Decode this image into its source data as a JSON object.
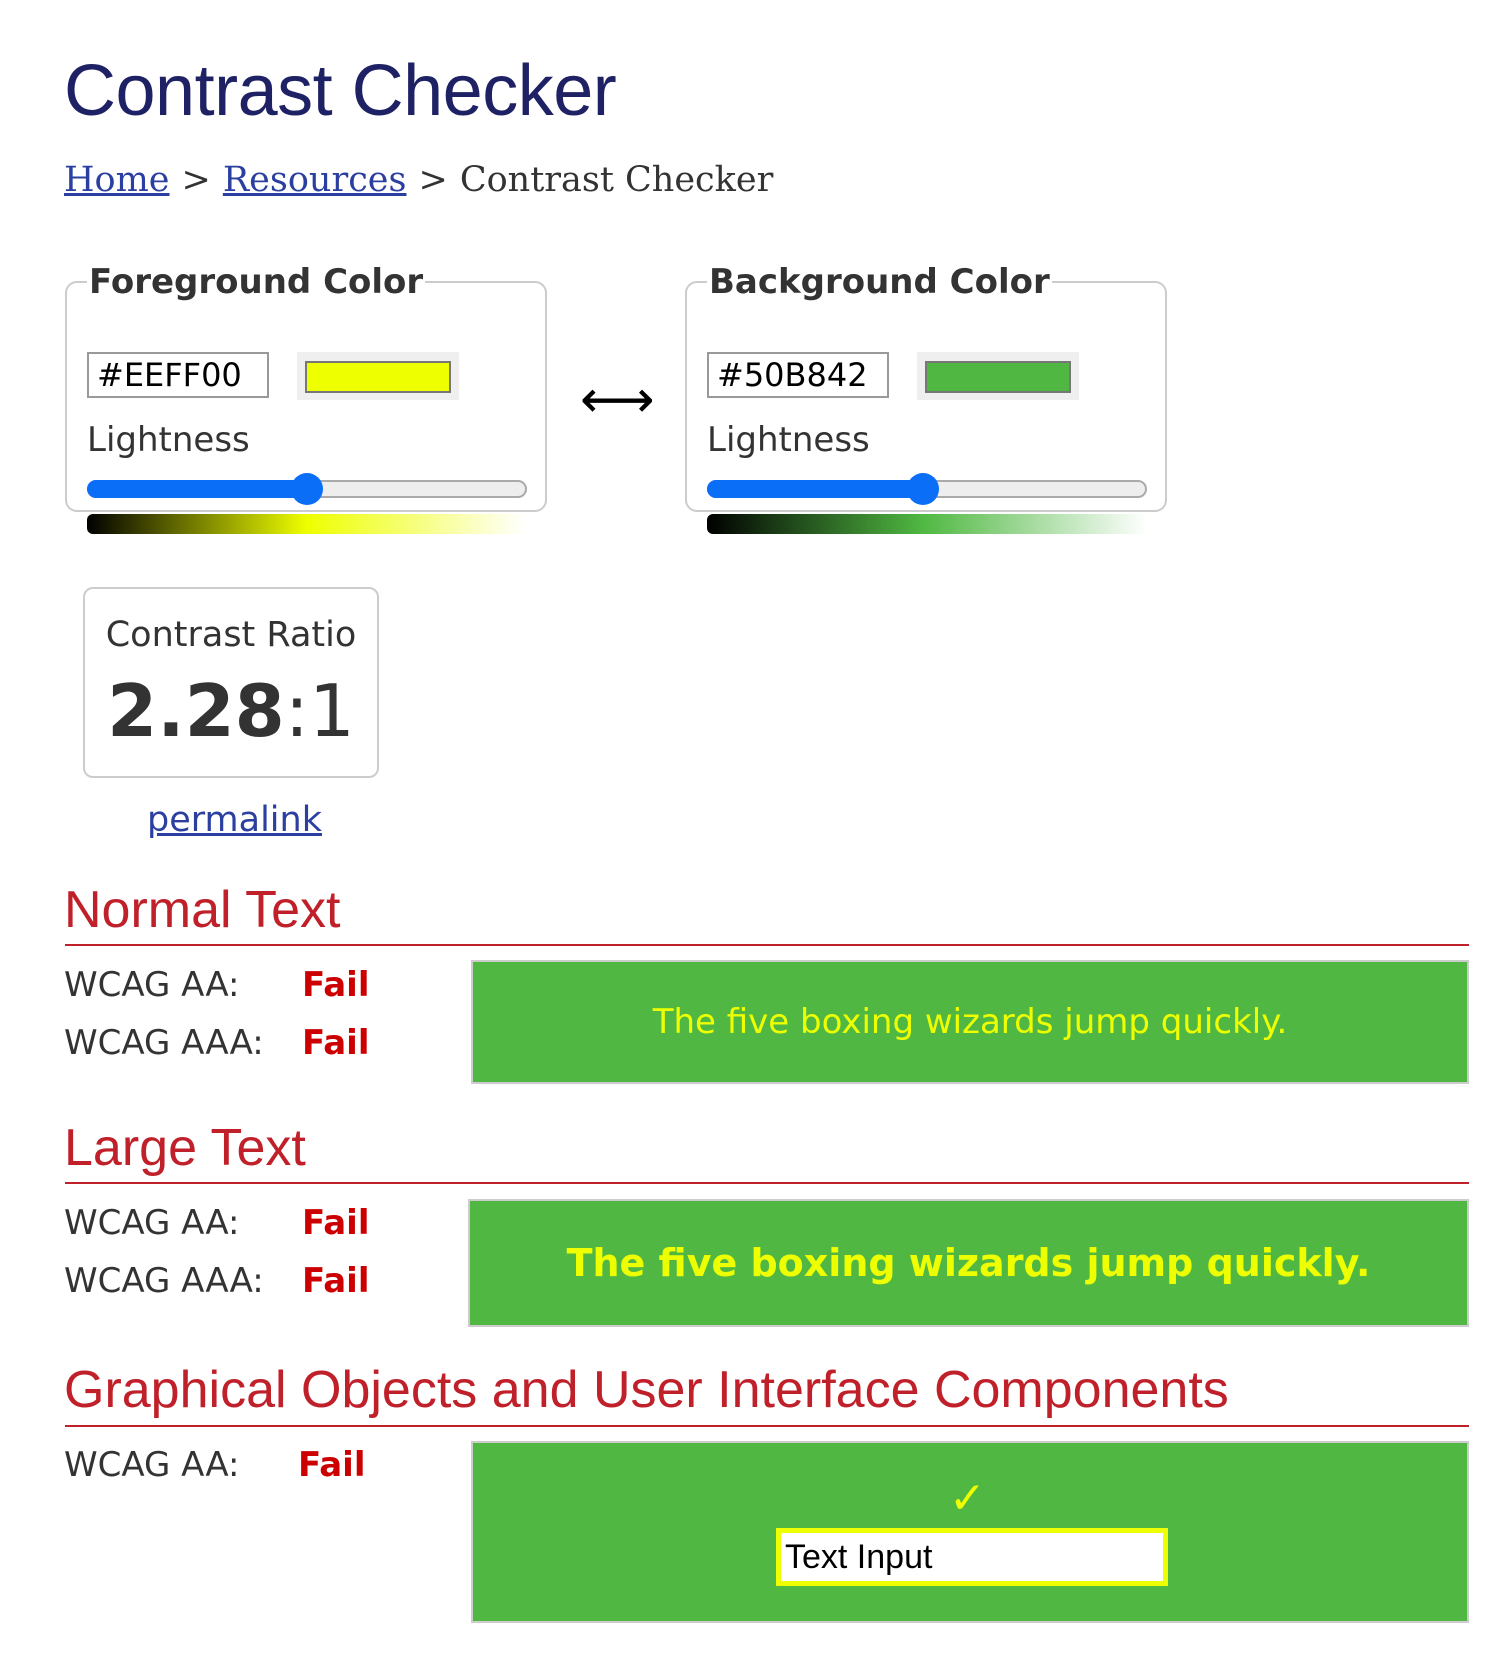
{
  "page": {
    "title": "Contrast Checker"
  },
  "breadcrumb": {
    "items": [
      {
        "label": "Home",
        "link": true
      },
      {
        "label": "Resources",
        "link": true
      },
      {
        "label": "Contrast Checker",
        "link": false
      }
    ],
    "separator": ">"
  },
  "foreground": {
    "legend": "Foreground Color",
    "hex_value": "#EEFF00",
    "swatch_color": "#eeff00",
    "lightness_label": "Lightness",
    "lightness_percent": 50
  },
  "background": {
    "legend": "Background Color",
    "hex_value": "#50B842",
    "swatch_color": "#50b842",
    "lightness_label": "Lightness",
    "lightness_percent": 49
  },
  "swap": {
    "icon": "left-right-arrow-icon",
    "glyph": "⟷"
  },
  "contrast": {
    "label": "Contrast Ratio",
    "ratio_bold": "2.28",
    "ratio_rest": ":1"
  },
  "permalink": {
    "label": "permalink"
  },
  "sections": {
    "normal": {
      "heading": "Normal Text",
      "rows": [
        {
          "label": "WCAG AA:",
          "result": "Fail"
        },
        {
          "label": "WCAG AAA:",
          "result": "Fail"
        }
      ],
      "sample": "The five boxing wizards jump quickly."
    },
    "large": {
      "heading": "Large Text",
      "rows": [
        {
          "label": "WCAG AA:",
          "result": "Fail"
        },
        {
          "label": "WCAG AAA:",
          "result": "Fail"
        }
      ],
      "sample": "The five boxing wizards jump quickly."
    },
    "graphical": {
      "heading": "Graphical Objects and User Interface Components",
      "rows": [
        {
          "label": "WCAG AA:",
          "result": "Fail"
        }
      ],
      "check_glyph": "✓",
      "text_input_value": "Text Input"
    }
  },
  "colors": {
    "title": "#1e2163",
    "link": "#2a3fa0",
    "section_heading": "#c0202a",
    "fail": "#cc0000",
    "slider_accent": "#0a6ef7"
  }
}
